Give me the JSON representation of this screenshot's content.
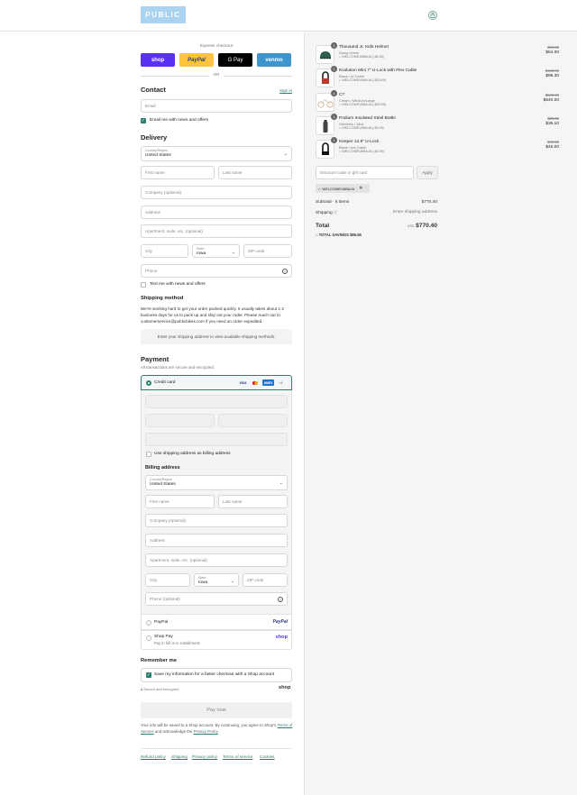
{
  "header": {
    "logo_text": "PUBLIC",
    "cart_icon": "shopping-bag-icon"
  },
  "express": {
    "label": "Express checkout",
    "buttons": [
      {
        "label": "shop",
        "color": "#5a31f4"
      },
      {
        "label": "PayPal",
        "color": "#ffc439"
      },
      {
        "label": "G Pay",
        "color": "#000000"
      },
      {
        "label": "venmo",
        "color": "#3d95ce"
      }
    ],
    "or": "OR"
  },
  "contact": {
    "title": "Contact",
    "signin": "Sign in",
    "email_placeholder": "Email",
    "news_label": "Email me with news and offers"
  },
  "delivery": {
    "title": "Delivery",
    "country_label": "Country/Region",
    "country_value": "United States",
    "first_name": "First name",
    "last_name": "Last name",
    "company": "Company (optional)",
    "address": "Address",
    "apartment": "Apartment, suite, etc. (optional)",
    "city": "City",
    "state_label": "State",
    "state_value": "Iowa",
    "zip": "ZIP code",
    "phone": "Phone",
    "text_label": "Text me with news and offers"
  },
  "shipping": {
    "title": "Shipping method",
    "body": "We're working hard to get your order packed quickly. It usually takes about 1-2 business days for us to pack up and ship out your order. Please reach out to customerservice@publicbikes.com if you need an order expedited.",
    "notice": "Enter your shipping address to view available shipping methods."
  },
  "payment": {
    "title": "Payment",
    "subtitle": "All transactions are secure and encrypted.",
    "credit_card": "Credit card",
    "more_cards": "+4",
    "use_shipping": "Use shipping address as billing address",
    "billing_title": "Billing address",
    "phone_optional": "Phone (optional)",
    "paypal": "PayPal",
    "shoppay": "Shop Pay",
    "shoppay_sub": "Pay in full or in installments",
    "shop_logo": "shop",
    "paypal_logo": "PayPal"
  },
  "remember": {
    "title": "Remember me",
    "label": "Save my information for a faster checkout with a Shop account",
    "secure": "Secure and encrypted",
    "shop_logo": "shop"
  },
  "paynow": "Pay now",
  "legal": {
    "text1": "Your info will be saved to a Shop account. By continuing, you agree to Shop's",
    "tos": "Terms of Service",
    "and": "and acknowledge the",
    "privacy": "Privacy Policy",
    "period": "."
  },
  "footer": [
    "Refund policy",
    "Shipping",
    "Privacy policy",
    "Terms of service",
    "Cookies"
  ],
  "cart": {
    "items": [
      {
        "qty": "1",
        "name": "Thousand Jr. Kids Helmet",
        "variant": "Going Green",
        "discount": "WELCOMEVABAJA (-$6.00)",
        "orig": "$60.00",
        "price": "$54.00"
      },
      {
        "qty": "1",
        "name": "Evolution Mini 7\" U-Lock with Flex Cable",
        "variant": "Black / w/ Cable",
        "discount": "WELCOMEVABAJA (-$10.69)",
        "orig": "$106.99",
        "price": "$96.30"
      },
      {
        "qty": "1",
        "name": "C7",
        "variant": "Cream / Medium/Large",
        "discount": "WELCOMEVABAJA (-$59.99)",
        "orig": "$599.99",
        "price": "$540.00"
      },
      {
        "qty": "1",
        "name": "Podium Insulated Steel Bottle",
        "variant": "Stainless / 18oz",
        "discount": "WELCOMEVABAJA (-$3.90)",
        "orig": "$39.00",
        "price": "$35.10"
      },
      {
        "qty": "1",
        "name": "Keeper 12.8\" U-Lock",
        "variant": "Black / w/o Cable",
        "discount": "WELCOMEVABAJA (-$4.99)",
        "orig": "$49.99",
        "price": "$45.00"
      }
    ],
    "discount_placeholder": "Discount code or gift card",
    "apply": "Apply",
    "code_chip": "WELCOMEVABAJA",
    "subtotal_label": "Subtotal · 5 items",
    "subtotal_value": "$770.40",
    "shipping_label": "Shipping",
    "shipping_value": "Enter shipping address",
    "total_label": "Total",
    "currency": "USD",
    "total_value": "$770.40",
    "savings_label": "TOTAL SAVINGS",
    "savings_value": "$85.56"
  }
}
